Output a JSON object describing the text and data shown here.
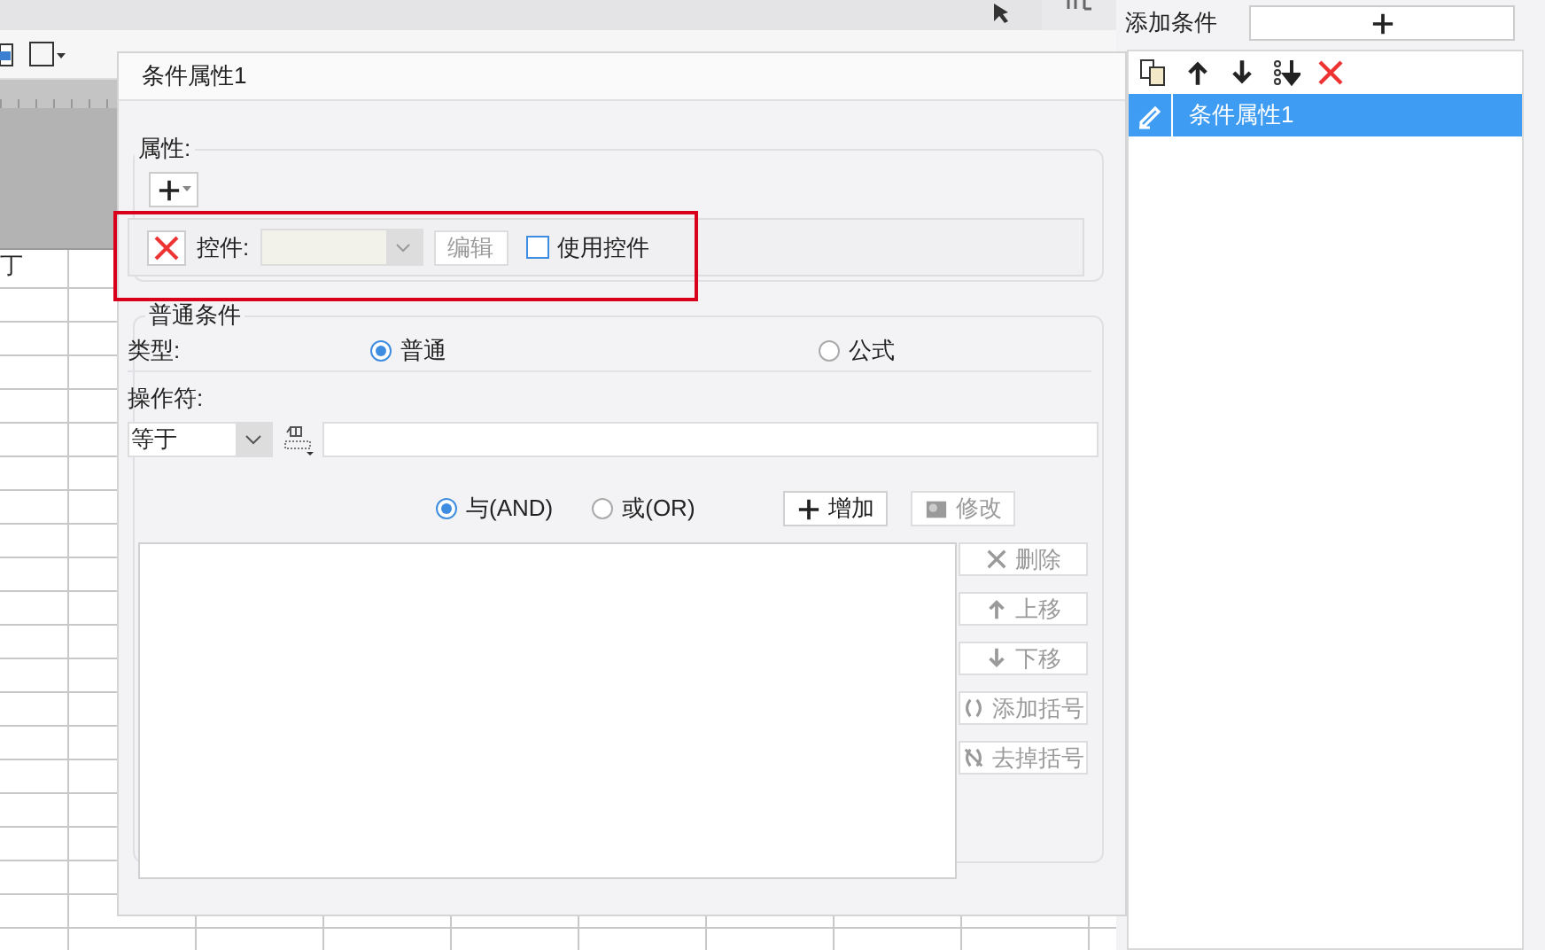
{
  "sheet": {
    "cell_text": "丁"
  },
  "dialog": {
    "title": "条件属性1",
    "property_section": {
      "legend": "属性:",
      "control_label": "控件:",
      "edit_button": {
        "label": "编辑",
        "disabled": true
      },
      "use_control": {
        "label": "使用控件",
        "checked": false
      }
    },
    "normal_section": {
      "legend": "普通条件",
      "type_label": "类型:",
      "type_options": [
        {
          "label": "普通",
          "selected": true
        },
        {
          "label": "公式",
          "selected": false
        }
      ],
      "operator_label": "操作符:",
      "operator": {
        "value": "等于"
      },
      "join_options": [
        {
          "label": "与(AND)",
          "selected": true
        },
        {
          "label": "或(OR)",
          "selected": false
        }
      ],
      "actions": [
        {
          "label": "增加",
          "kind": "plus",
          "disabled": false
        },
        {
          "label": "修改",
          "kind": "gear",
          "disabled": true
        }
      ],
      "list_buttons": [
        {
          "label": "删除",
          "kind": "x",
          "disabled": true
        },
        {
          "label": "上移",
          "kind": "up",
          "disabled": true
        },
        {
          "label": "下移",
          "kind": "down",
          "disabled": true
        },
        {
          "label": "添加括号",
          "kind": "paren",
          "disabled": true
        },
        {
          "label": "去掉括号",
          "kind": "unparen",
          "disabled": true
        }
      ]
    }
  },
  "side_panel": {
    "add_label": "添加条件",
    "conditions": [
      {
        "label": "条件属性1",
        "selected": true
      }
    ]
  }
}
